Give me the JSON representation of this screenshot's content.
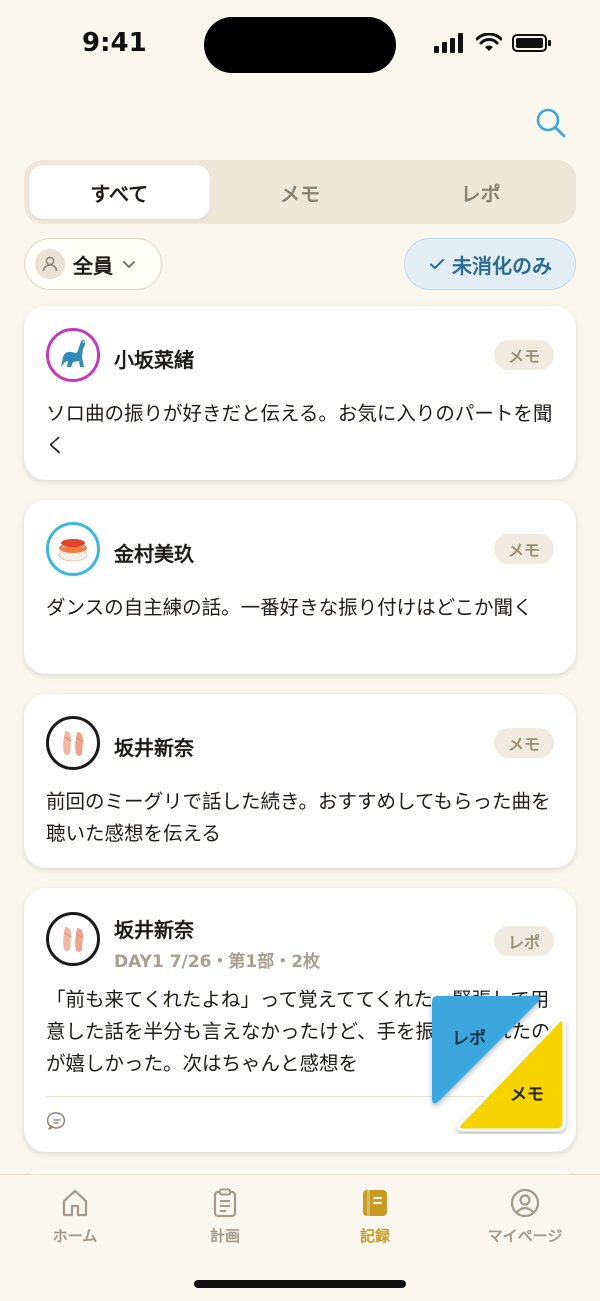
{
  "status": {
    "time": "9:41"
  },
  "tabs": [
    {
      "label": "すべて",
      "active": true
    },
    {
      "label": "メモ",
      "active": false
    },
    {
      "label": "レポ",
      "active": false
    }
  ],
  "filters": {
    "member": "全員",
    "unread": "未消化のみ"
  },
  "cards": [
    {
      "name": "小坂菜緒",
      "badge": "メモ",
      "text": "ソロ曲の振りが好きだと伝える。お気に入りのパートを聞く",
      "avatar_icon": "dinosaur-icon",
      "avatar_ring": "#c53ab7"
    },
    {
      "name": "金村美玖",
      "badge": "メモ",
      "text": "ダンスの自主練の話。一番好きな振り付けはどこか聞く",
      "avatar_icon": "sushi-icon",
      "avatar_ring": "#3bb7e0"
    },
    {
      "name": "坂井新奈",
      "badge": "メモ",
      "text": "前回のミーグリで話した続き。おすすめしてもらった曲を聴いた感想を伝える",
      "avatar_icon": "pointe-shoes-icon",
      "avatar_ring": "#1a1a1a"
    },
    {
      "name": "坂井新奈",
      "subtitle": "DAY1 7/26・第1部・2枚",
      "badge": "レポ",
      "text": "「前も来てくれたよね」って覚えててくれた。緊張して用意した話を半分も言えなかったけど、手を振ってくれたのが嬉しかった。次はちゃんと感想を",
      "avatar_icon": "pointe-shoes-icon",
      "avatar_ring": "#1a1a1a"
    }
  ],
  "fab": {
    "repo": "レポ",
    "memo": "メモ"
  },
  "nav": [
    {
      "label": "ホーム",
      "icon": "home-icon",
      "active": false
    },
    {
      "label": "計画",
      "icon": "clipboard-icon",
      "active": false
    },
    {
      "label": "記録",
      "icon": "notebook-icon",
      "active": true
    },
    {
      "label": "マイページ",
      "icon": "profile-icon",
      "active": false
    }
  ],
  "colors": {
    "accent": "#c79a22",
    "background": "#faf7ef",
    "fab_repo": "#3aa7de",
    "fab_memo": "#f5d400"
  }
}
